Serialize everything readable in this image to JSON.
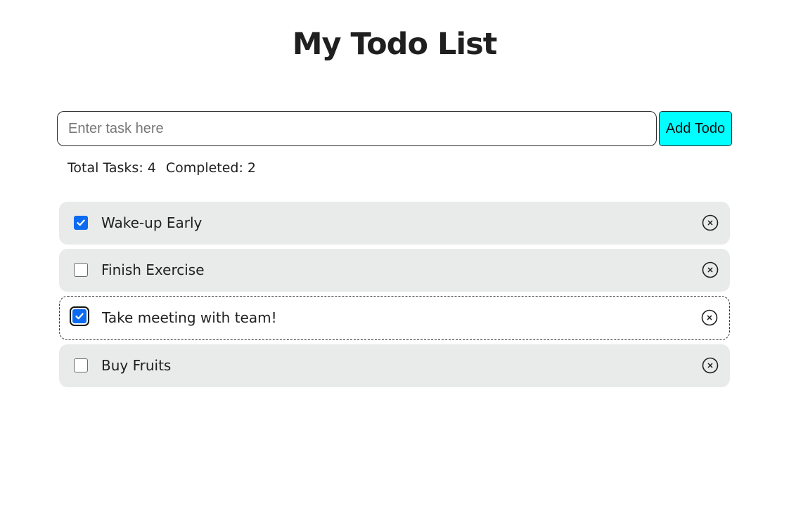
{
  "header": {
    "title": "My Todo List"
  },
  "form": {
    "input_placeholder": "Enter task here",
    "input_value": "",
    "add_button_label": "Add Todo",
    "add_button_color": "#00ffff"
  },
  "stats": {
    "total_label": "Total Tasks: 4",
    "completed_label": "Completed: 2"
  },
  "todos": [
    {
      "text": "Wake-up Early",
      "checked": true,
      "focused": false,
      "delete_icon": "circle-x-icon"
    },
    {
      "text": "Finish Exercise",
      "checked": false,
      "focused": false,
      "delete_icon": "circle-x-icon"
    },
    {
      "text": "Take meeting with team!",
      "checked": true,
      "focused": true,
      "delete_icon": "circle-x-icon"
    },
    {
      "text": "Buy Fruits",
      "checked": false,
      "focused": false,
      "delete_icon": "circle-x-icon"
    }
  ],
  "colors": {
    "checkbox_checked": "#0b6cf2",
    "item_background": "#e9eaea"
  }
}
